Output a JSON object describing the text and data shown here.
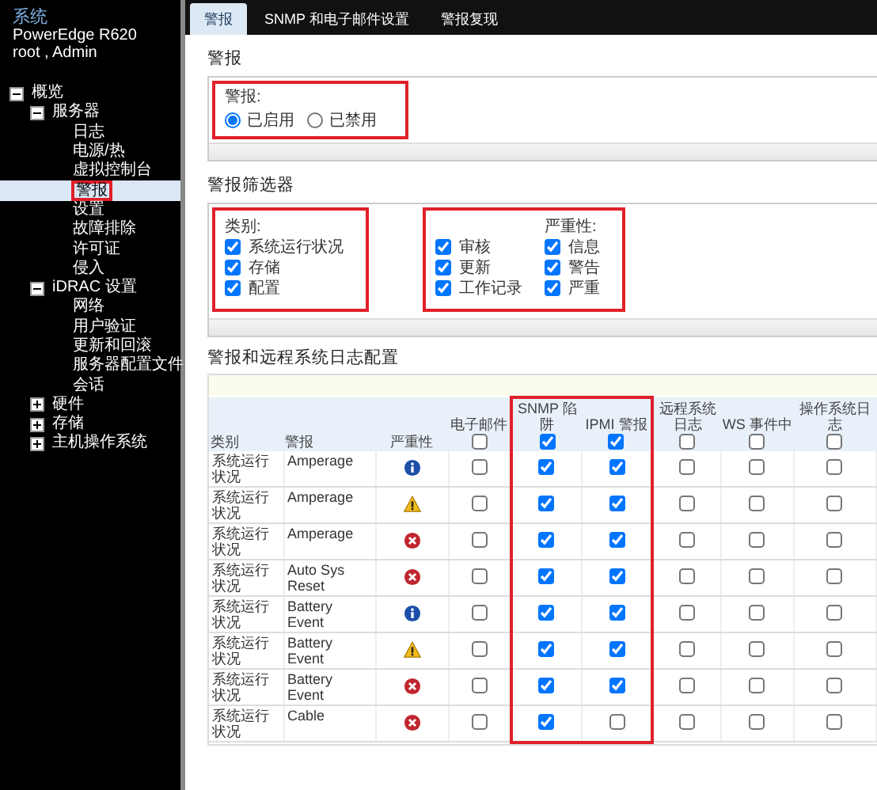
{
  "sidebar": {
    "title": "系统",
    "model": "PowerEdge R620",
    "user": "root , Admin",
    "tree": [
      {
        "label": "概览",
        "expanded": true,
        "selected": false,
        "children": [
          {
            "label": "服务器",
            "expanded": true,
            "selected": false,
            "children": [
              {
                "label": "日志",
                "selected": false
              },
              {
                "label": "电源/热",
                "selected": false
              },
              {
                "label": "虚拟控制台",
                "selected": false
              },
              {
                "label": "警报",
                "selected": true,
                "highlighted": true
              },
              {
                "label": "设置",
                "selected": false
              },
              {
                "label": "故障排除",
                "selected": false
              },
              {
                "label": "许可证",
                "selected": false
              },
              {
                "label": "侵入",
                "selected": false
              }
            ]
          },
          {
            "label": "iDRAC 设置",
            "expanded": true,
            "selected": false,
            "children": [
              {
                "label": "网络",
                "selected": false
              },
              {
                "label": "用户验证",
                "selected": false
              },
              {
                "label": "更新和回滚",
                "selected": false
              },
              {
                "label": "服务器配置文件",
                "selected": false
              },
              {
                "label": "会话",
                "selected": false
              }
            ]
          },
          {
            "label": "硬件",
            "expanded": false,
            "selected": false
          },
          {
            "label": "存储",
            "expanded": false,
            "selected": false
          },
          {
            "label": "主机操作系统",
            "expanded": false,
            "selected": false
          }
        ]
      }
    ]
  },
  "tabs": [
    {
      "label": "警报",
      "selected": true
    },
    {
      "label": "SNMP 和电子邮件设置",
      "selected": false
    },
    {
      "label": "警报复现",
      "selected": false
    }
  ],
  "alerts": {
    "title": "警报",
    "label": "警报:",
    "highlighted": true,
    "options": [
      {
        "label": "已启用",
        "selected": true
      },
      {
        "label": "已禁用",
        "selected": false
      }
    ]
  },
  "filters": {
    "title": "警报筛选器",
    "groups": [
      {
        "highlighted": true,
        "columns": [
          {
            "title": "类别:",
            "items": [
              {
                "label": "系统运行状况",
                "checked": true
              },
              {
                "label": "存储",
                "checked": true
              },
              {
                "label": "配置",
                "checked": true
              }
            ]
          }
        ]
      },
      {
        "highlighted": true,
        "columns": [
          {
            "items": [
              {
                "label": "审核",
                "checked": true
              },
              {
                "label": "更新",
                "checked": true
              },
              {
                "label": "工作记录",
                "checked": true
              }
            ]
          },
          {
            "title": "严重性:",
            "items": [
              {
                "label": "信息",
                "checked": true
              },
              {
                "label": "警告",
                "checked": true
              },
              {
                "label": "严重",
                "checked": true
              }
            ]
          }
        ]
      }
    ]
  },
  "table": {
    "title": "警报和远程系统日志配置",
    "columns": [
      {
        "label": "类别"
      },
      {
        "label": "警报"
      },
      {
        "label": "严重性"
      },
      {
        "label": "电子邮件",
        "checked": false,
        "highlighted": false
      },
      {
        "label": "SNMP 陷阱",
        "checked": true,
        "highlighted": true
      },
      {
        "label": "IPMI 警报",
        "checked": true,
        "highlighted": true
      },
      {
        "label": "远程系统日志",
        "checked": false,
        "highlighted": false
      },
      {
        "label": "WS 事件中",
        "checked": false,
        "highlighted": false
      },
      {
        "label": "操作系统日志",
        "checked": false,
        "highlighted": false
      }
    ],
    "rows": [
      {
        "category": "系统运行状况",
        "alert": "Amperage",
        "kind": "info",
        "checks": [
          false,
          true,
          true,
          false,
          false,
          false
        ]
      },
      {
        "category": "系统运行状况",
        "alert": "Amperage",
        "kind": "warning",
        "checks": [
          false,
          true,
          true,
          false,
          false,
          false
        ]
      },
      {
        "category": "系统运行状况",
        "alert": "Amperage",
        "kind": "critical",
        "checks": [
          false,
          true,
          true,
          false,
          false,
          false
        ]
      },
      {
        "category": "系统运行状况",
        "alert": "Auto Sys Reset",
        "kind": "critical",
        "checks": [
          false,
          true,
          true,
          false,
          false,
          false
        ]
      },
      {
        "category": "系统运行状况",
        "alert": "Battery Event",
        "kind": "info",
        "checks": [
          false,
          true,
          true,
          false,
          false,
          false
        ]
      },
      {
        "category": "系统运行状况",
        "alert": "Battery Event",
        "kind": "warning",
        "checks": [
          false,
          true,
          true,
          false,
          false,
          false
        ]
      },
      {
        "category": "系统运行状况",
        "alert": "Battery Event",
        "kind": "critical",
        "checks": [
          false,
          true,
          true,
          false,
          false,
          false
        ]
      },
      {
        "category": "系统运行状况",
        "alert": "Cable",
        "kind": "critical",
        "checks": [
          false,
          true,
          false,
          false,
          false,
          false
        ]
      }
    ]
  }
}
